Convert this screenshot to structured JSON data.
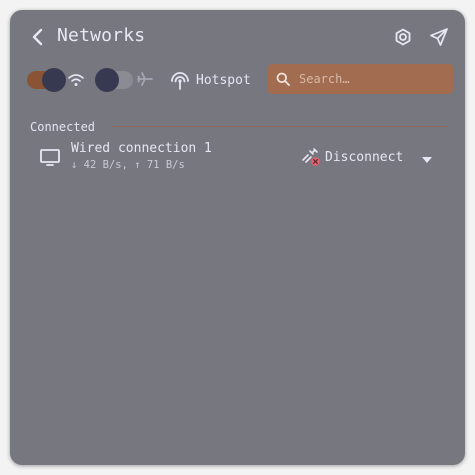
{
  "header": {
    "title": "Networks",
    "back_icon": "chevron-left-icon",
    "settings_icon": "gear-icon",
    "send_icon": "send-icon"
  },
  "toolbar": {
    "wifi_toggle_on": true,
    "airplane_toggle_on": false,
    "hotspot_label": "Hotspot",
    "search_placeholder": "Search…"
  },
  "sections": {
    "connected_label": "Connected"
  },
  "connections": [
    {
      "name": "Wired connection 1",
      "speed": "↓ 42 B/s, ↑ 71 B/s",
      "action_label": "Disconnect"
    }
  ],
  "colors": {
    "panel_bg": "#777780",
    "accent": "#a16c4f",
    "toggle_on": "#8a5333",
    "knob": "#363950",
    "error": "#e5626f"
  }
}
